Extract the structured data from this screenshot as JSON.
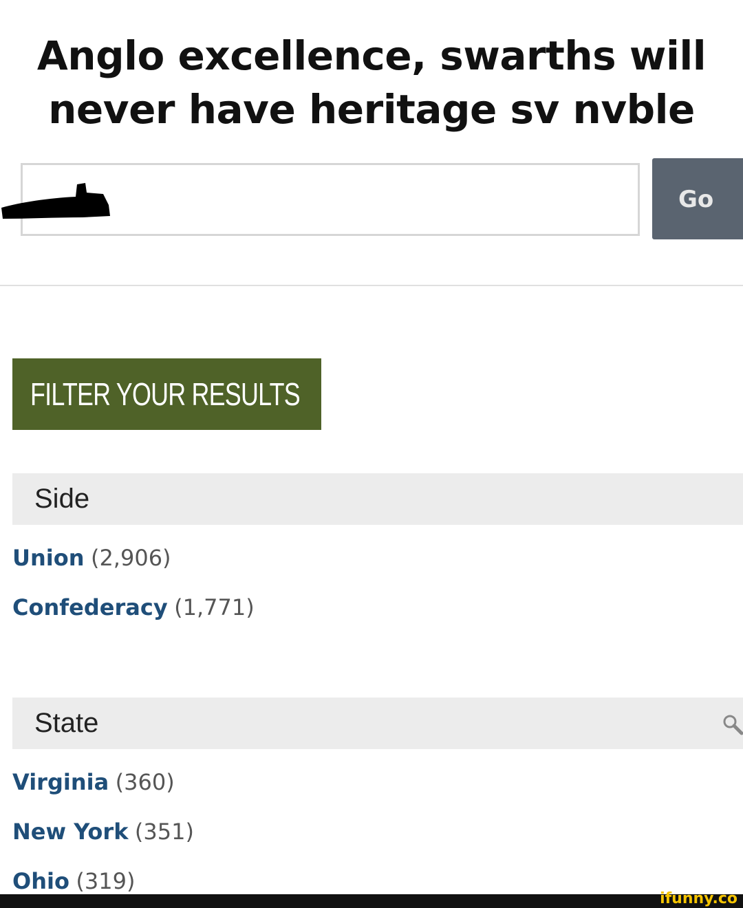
{
  "caption": {
    "line1": "Anglo excellence, swarths will",
    "line2": "never have heritage sv nvble"
  },
  "search": {
    "value": "",
    "go_label": "Go"
  },
  "filter_banner": "FILTER YOUR RESULTS",
  "side": {
    "header": "Side",
    "items": [
      {
        "name": "Union",
        "count": "(2,906)"
      },
      {
        "name": "Confederacy",
        "count": "(1,771)"
      }
    ]
  },
  "state": {
    "header": "State",
    "items": [
      {
        "name": "Virginia",
        "count": "(360)"
      },
      {
        "name": "New York",
        "count": "(351)"
      },
      {
        "name": "Ohio",
        "count": "(319)"
      }
    ]
  },
  "watermark": "ifunny.co",
  "colors": {
    "banner_green": "#4f6228",
    "link_blue": "#1f4e79",
    "go_button": "#5a6470"
  },
  "icons": [
    "search-icon"
  ]
}
